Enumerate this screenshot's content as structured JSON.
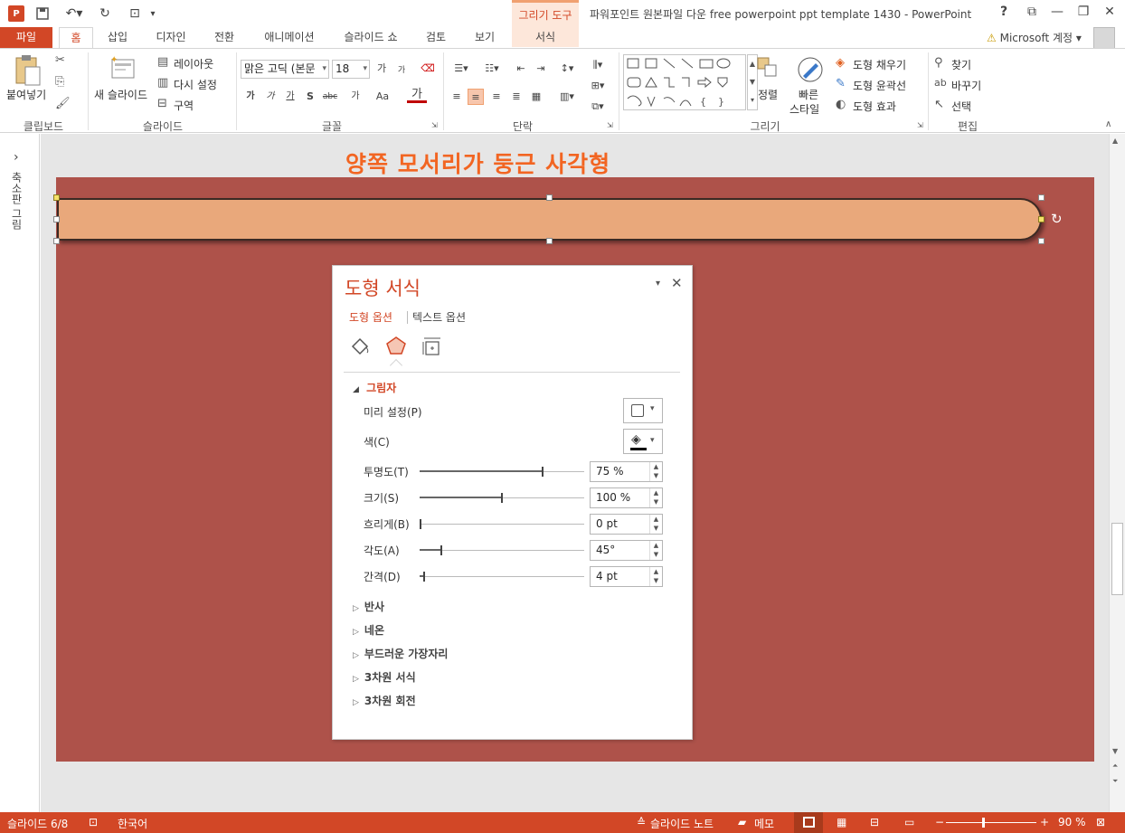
{
  "window": {
    "title": "파워포인트 원본파일 다운 free powerpoint ppt template 1430 - PowerPoint",
    "app_icon": "P",
    "help": "?",
    "buttons": {
      "minimize": "—",
      "close": "✕"
    }
  },
  "context_tab": {
    "group": "그리기 도구",
    "tab": "서식"
  },
  "tabs": [
    "파일",
    "홈",
    "삽입",
    "디자인",
    "전환",
    "애니메이션",
    "슬라이드 쇼",
    "검토",
    "보기"
  ],
  "account": {
    "label": "Microsoft 계정",
    "warning_icon": "⚠"
  },
  "ribbon": {
    "clipboard": {
      "paste": "붙여넣기",
      "label": "클립보드"
    },
    "slides": {
      "new_slide": "새 슬라이드",
      "layout": "레이아웃",
      "reset": "다시 설정",
      "section": "구역",
      "label": "슬라이드"
    },
    "font": {
      "font_name": "맑은 고딕 (본문",
      "font_size": "18",
      "grow": "가",
      "shrink": "가",
      "bold": "가",
      "italic": "가",
      "underline": "가",
      "shadow": "S",
      "strike": "abc",
      "spacing": "가",
      "case": "Aa",
      "color": "가",
      "label": "글꼴"
    },
    "paragraph": {
      "label": "단락"
    },
    "drawing": {
      "arrange": "정렬",
      "quick_styles_1": "빠른",
      "quick_styles_2": "스타일",
      "fill": "도형 채우기",
      "outline": "도형 윤곽선",
      "effects": "도형 효과",
      "label": "그리기"
    },
    "editing": {
      "find": "찾기",
      "replace": "바꾸기",
      "select": "선택",
      "label": "편집"
    }
  },
  "thumbnail_panel": {
    "label": "축소판 그림",
    "toggle": "›"
  },
  "slide": {
    "title": "양쪽 모서리가 둥근 사각형",
    "background": "#ae524a",
    "shape_fill": "#e9a87b",
    "title_color": "#f26522"
  },
  "format_pane": {
    "title": "도형 서식",
    "tab_shape": "도형 옵션",
    "tab_text": "텍스트 옵션",
    "section": "그림자",
    "props": [
      {
        "label": "미리 설정(P)"
      },
      {
        "label": "색(C)"
      },
      {
        "label": "투명도(T)",
        "value": "75 %",
        "fraction": 0.75
      },
      {
        "label": "크기(S)",
        "value": "100 %",
        "fraction": 0.5
      },
      {
        "label": "흐리게(B)",
        "value": "0 pt",
        "fraction": 0.0
      },
      {
        "label": "각도(A)",
        "value": "45°",
        "fraction": 0.13
      },
      {
        "label": "간격(D)",
        "value": "4 pt",
        "fraction": 0.02
      }
    ],
    "collapsed_sections": [
      "반사",
      "네온",
      "부드러운 가장자리",
      "3차원 서식",
      "3차원 회전"
    ]
  },
  "statusbar": {
    "slide_pos": "슬라이드 6/8",
    "language": "한국어",
    "notes": "슬라이드 노트",
    "comments": "메모",
    "zoom": "90 %",
    "zoom_minus": "−",
    "zoom_plus": "+"
  },
  "colors": {
    "accent": "#d24726",
    "statusbar": "#d24726"
  }
}
